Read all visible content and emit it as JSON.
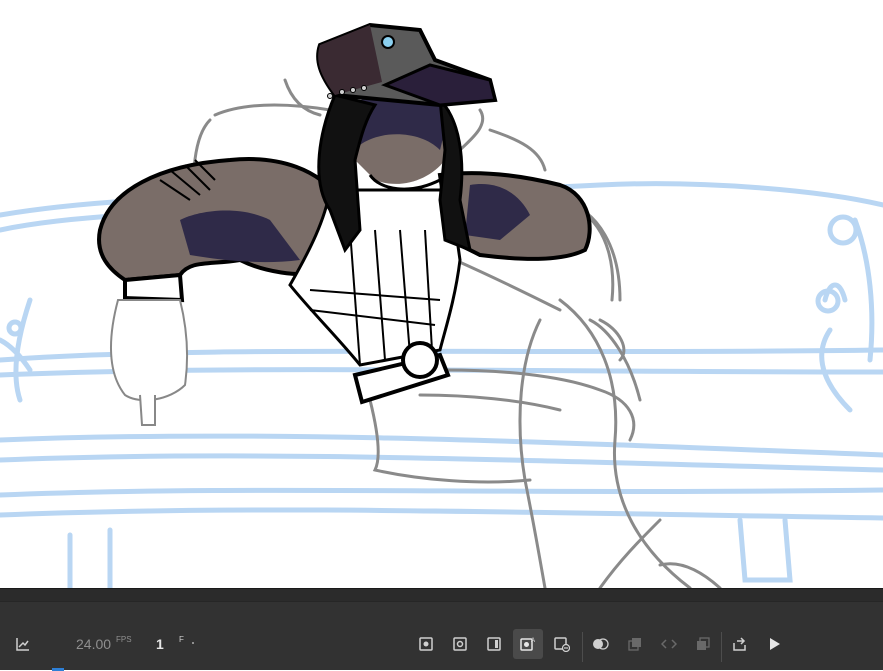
{
  "canvas": {
    "description_layers": [
      "sketch-guides",
      "couch-sketch",
      "character-ink"
    ]
  },
  "timeline": {
    "fps_value": "24.00",
    "fps_unit": "FPS",
    "frame_value": "1",
    "frame_unit": "F"
  },
  "toolbar": {
    "buttons": [
      {
        "name": "insert-keyframe-icon",
        "active": false,
        "disabled": false
      },
      {
        "name": "insert-blank-keyframe-icon",
        "active": false,
        "disabled": false
      },
      {
        "name": "insert-frame-icon",
        "active": false,
        "disabled": false
      },
      {
        "name": "auto-keyframe-icon",
        "active": true,
        "disabled": false
      },
      {
        "name": "remove-frame-icon",
        "active": false,
        "disabled": false
      },
      {
        "name": "onion-skin-icon",
        "active": false,
        "disabled": false
      },
      {
        "name": "edit-multiple-frames-icon",
        "active": false,
        "disabled": true
      },
      {
        "name": "loop-icon",
        "active": false,
        "disabled": true
      },
      {
        "name": "onion-outline-icon",
        "active": false,
        "disabled": true
      },
      {
        "name": "go-to-next-icon",
        "active": false,
        "disabled": false
      },
      {
        "name": "play-icon",
        "active": false,
        "disabled": false
      }
    ]
  },
  "colors": {
    "sketch_blue": "#b9d6f3",
    "sketch_gray": "#8a8a8a",
    "skin": "#7a6d68",
    "shadow": "#2f2a48",
    "hat": "#5a5a5a",
    "panel_bg": "#323232"
  }
}
